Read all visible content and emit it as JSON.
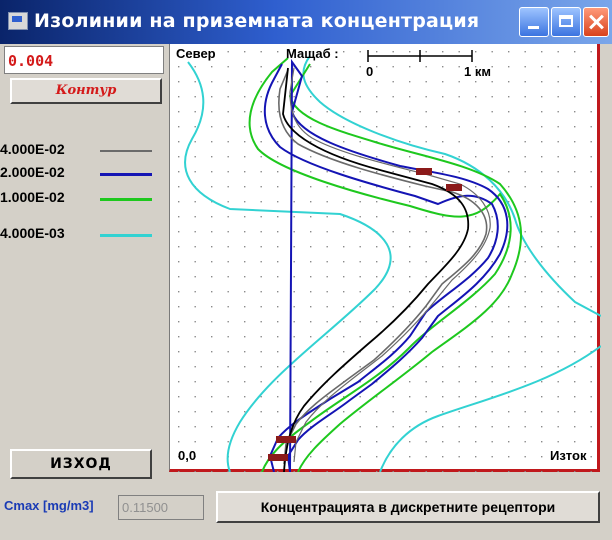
{
  "window": {
    "title": "Изолинии на приземната концентрация"
  },
  "sidebar": {
    "value": "0.004",
    "contour_button": "Контур",
    "legend": [
      {
        "label": "4.000E-02",
        "color": "#6a6a6a"
      },
      {
        "label": "2.000E-02",
        "color": "#1414b4"
      },
      {
        "label": "1.000E-02",
        "color": "#1ec81e"
      },
      {
        "label": "4.000E-03",
        "color": "#32d2d2"
      }
    ],
    "exit_button": "ИЗХОД"
  },
  "plot": {
    "north_label": "Север",
    "scale_label": "Мащаб :",
    "scale_zero": "0",
    "scale_one": "1 км",
    "origin_label": "0,0",
    "east_label": "Изток",
    "colors": {
      "frame": "#c0181c",
      "source": "#8b1a1a"
    }
  },
  "bottom": {
    "cmax_label": "Cmax [mg/m3]",
    "cmax_value": "0.11500",
    "receptors_button": "Концентрацията в дискретните рецептори"
  }
}
